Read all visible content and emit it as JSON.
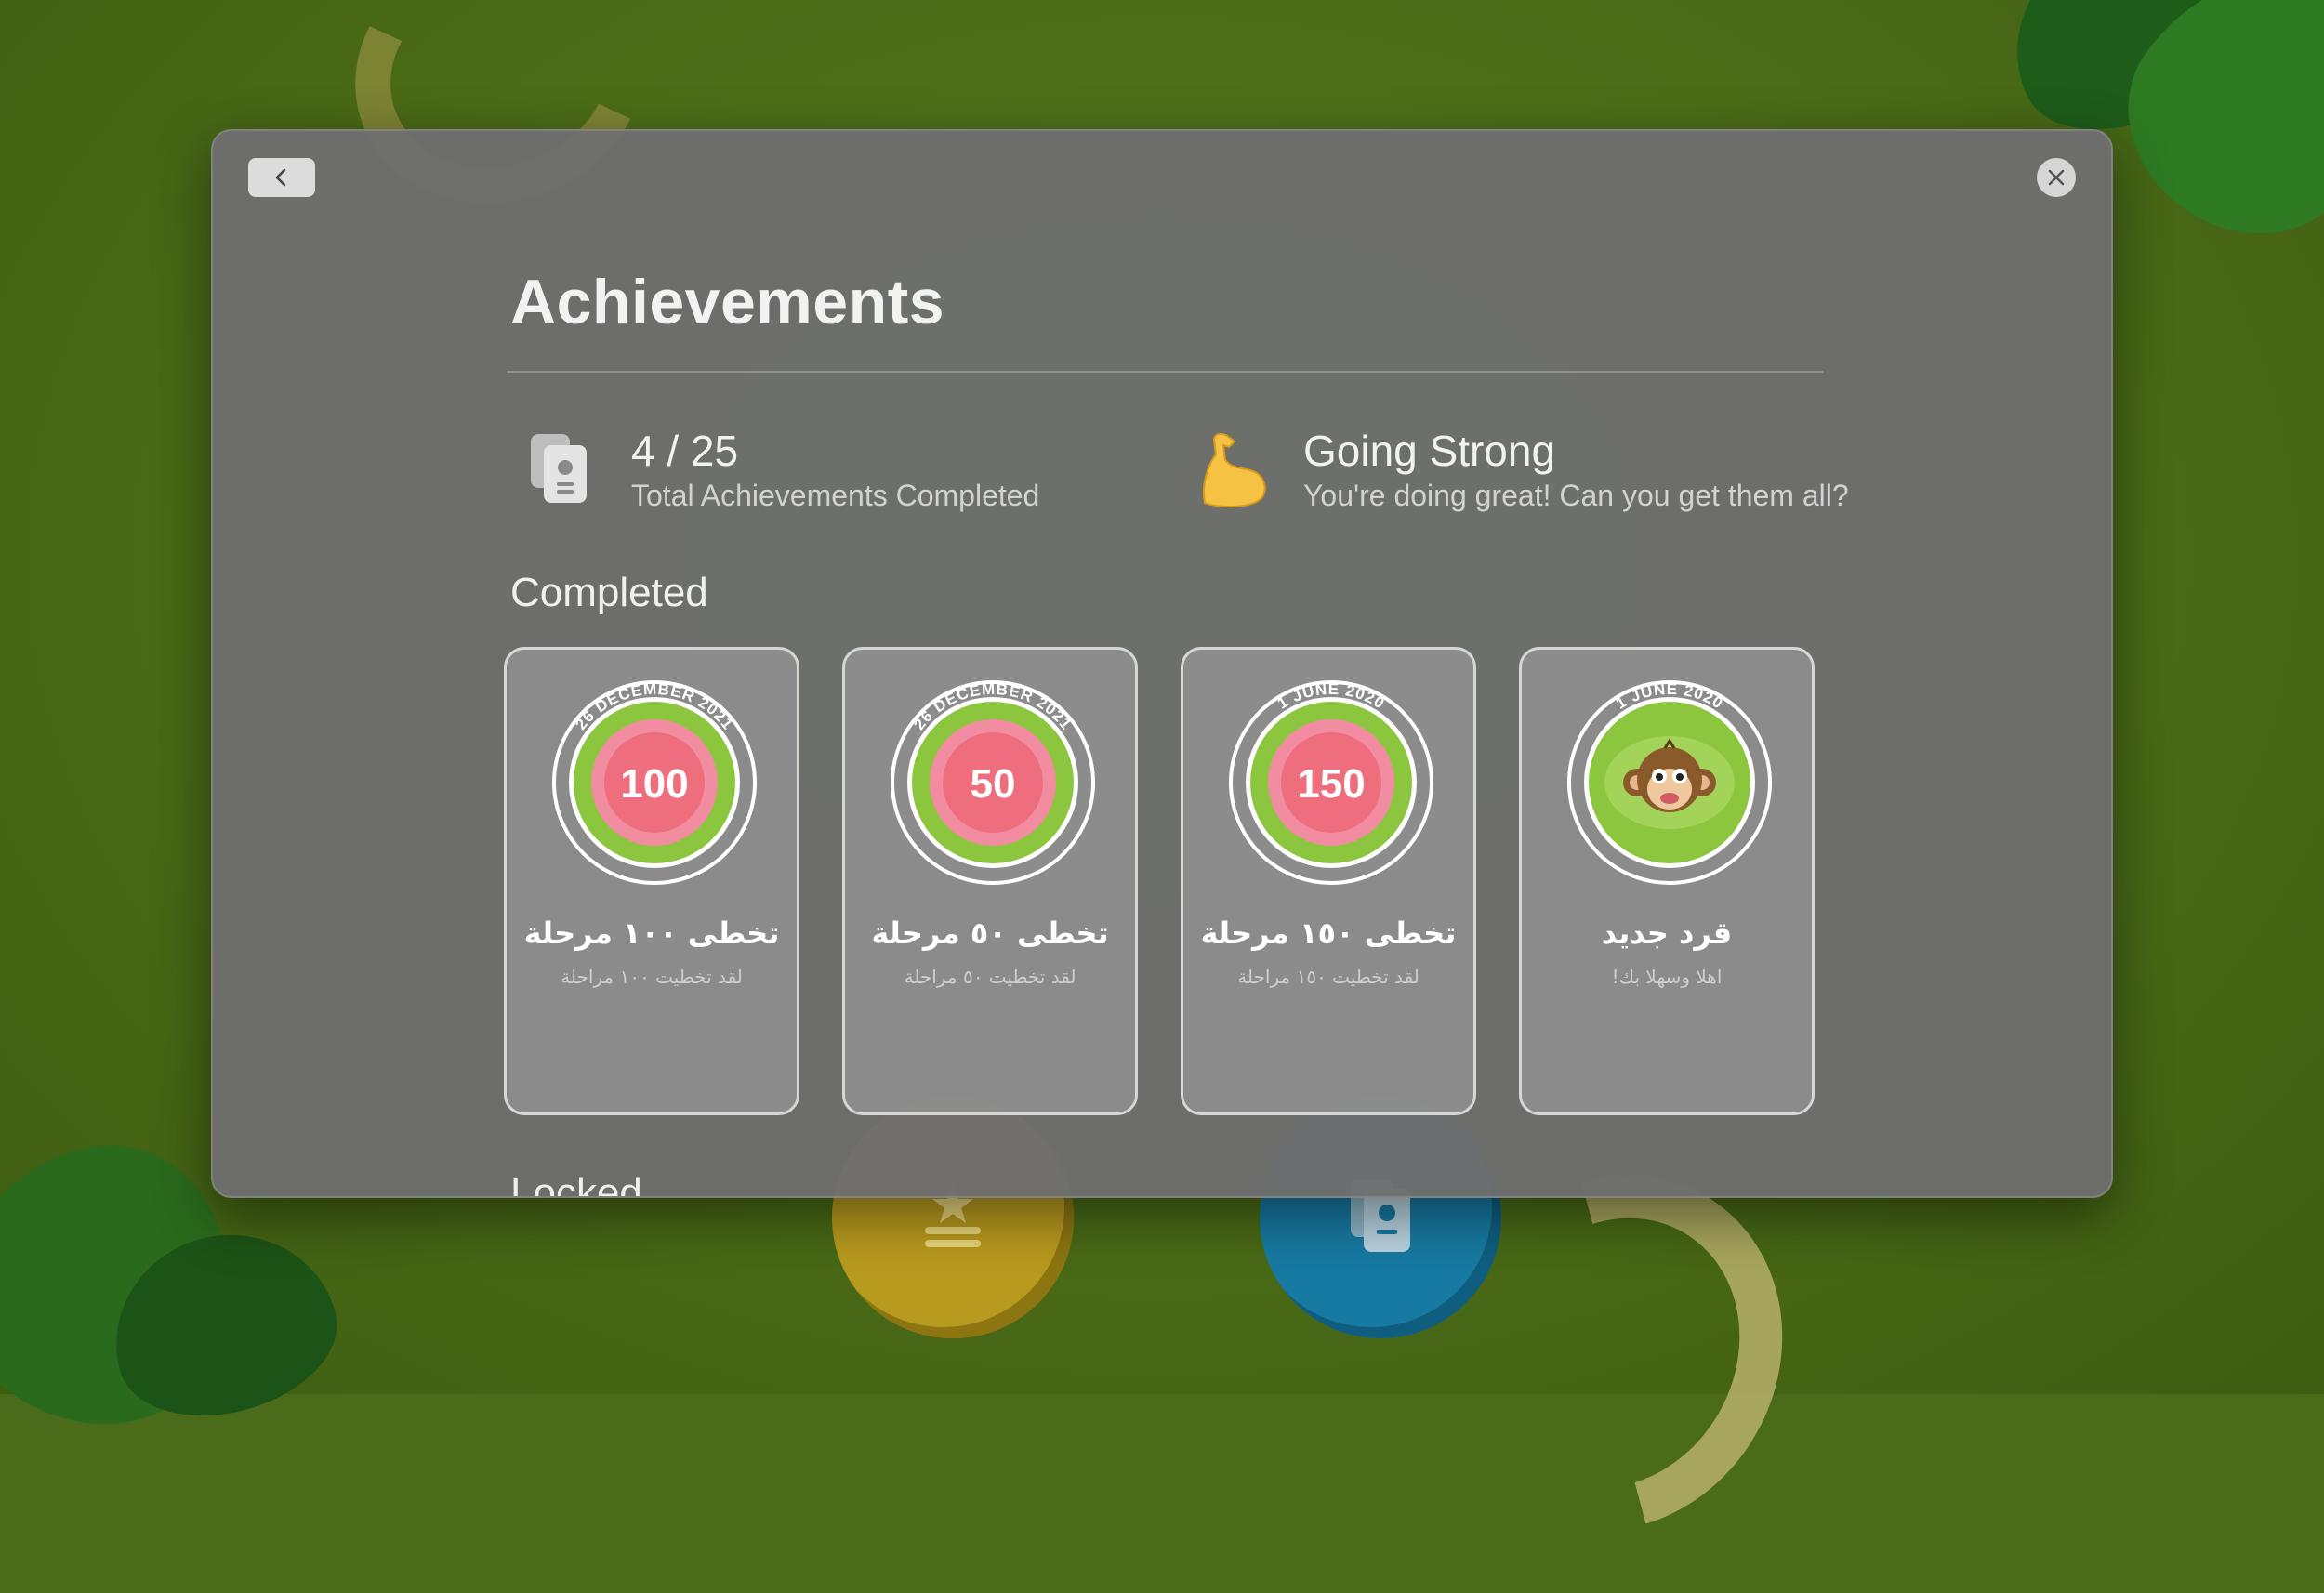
{
  "nav": {
    "back_label": "Back",
    "close_label": "Close"
  },
  "page": {
    "title": "Achievements"
  },
  "stats": {
    "total": {
      "value": "4 / 25",
      "label": "Total Achievements Completed",
      "icon": "achievement-cards-icon"
    },
    "streak": {
      "value": "Going Strong",
      "label": "You're doing great! Can you get them all?",
      "icon": "flexed-biceps-icon"
    }
  },
  "sections": {
    "completed": "Completed",
    "locked": "Locked"
  },
  "achievements": [
    {
      "date": "26 DECEMBER 2021",
      "badge_text": "100",
      "title": "تخطى ١٠٠ مرحلة",
      "subtitle": "لقد تخطيت ١٠٠ مراحلة",
      "type": "number"
    },
    {
      "date": "26 DECEMBER 2021",
      "badge_text": "50",
      "title": "تخطى ٥٠ مرحلة",
      "subtitle": "لقد تخطيت ٥٠ مراحلة",
      "type": "number"
    },
    {
      "date": "1 JUNE 2020",
      "badge_text": "150",
      "title": "تخطى ١٥٠ مرحلة",
      "subtitle": "لقد تخطيت ١٥٠ مراحلة",
      "type": "number"
    },
    {
      "date": "1 JUNE 2020",
      "badge_text": "",
      "title": "قرد جديد",
      "subtitle": "اهلا وسهلا بك!",
      "type": "monkey",
      "icon": "monkey-face-icon"
    }
  ],
  "colors": {
    "badge_green": "#8cc63f",
    "badge_pink_outer": "#f28ca0",
    "badge_pink_inner": "#ee6e7e",
    "modal_bg": "#6e6e6e"
  }
}
